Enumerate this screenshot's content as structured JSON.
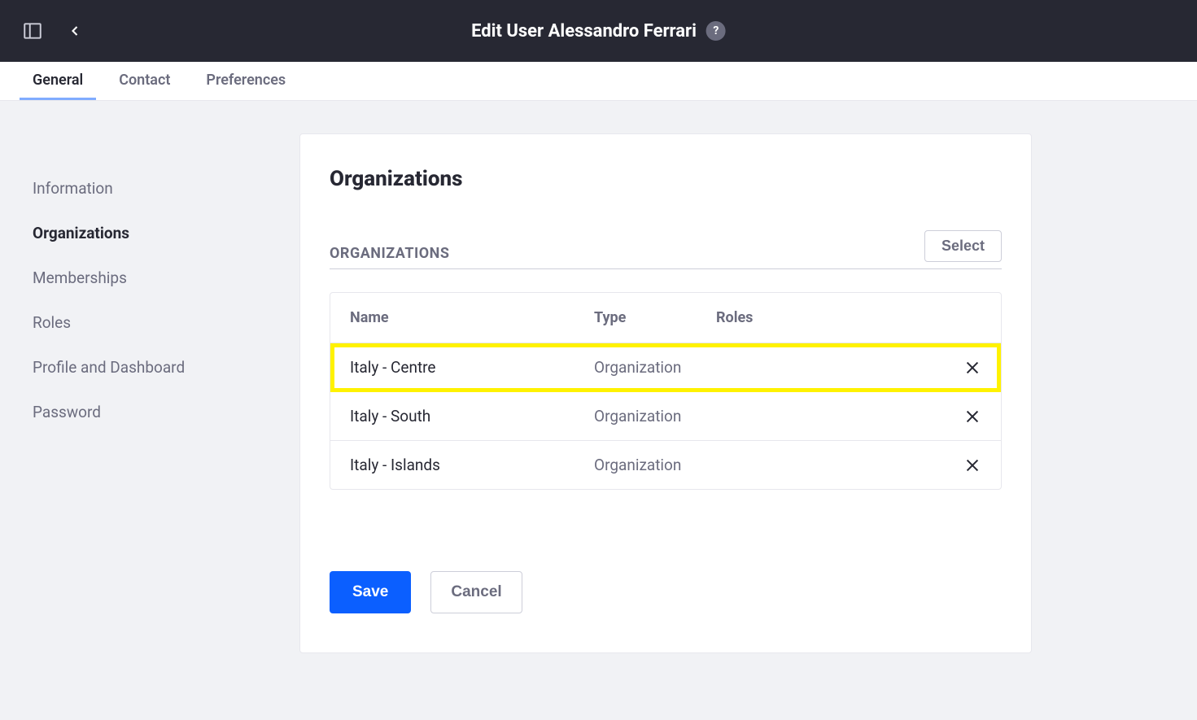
{
  "header": {
    "title": "Edit User Alessandro Ferrari",
    "help": "?"
  },
  "tabs": [
    {
      "label": "General",
      "active": true
    },
    {
      "label": "Contact",
      "active": false
    },
    {
      "label": "Preferences",
      "active": false
    }
  ],
  "sidebar": {
    "items": [
      {
        "label": "Information",
        "active": false
      },
      {
        "label": "Organizations",
        "active": true
      },
      {
        "label": "Memberships",
        "active": false
      },
      {
        "label": "Roles",
        "active": false
      },
      {
        "label": "Profile and Dashboard",
        "active": false
      },
      {
        "label": "Password",
        "active": false
      }
    ]
  },
  "panel": {
    "title": "Organizations",
    "section_label": "ORGANIZATIONS",
    "select_label": "Select"
  },
  "table": {
    "columns": {
      "name": "Name",
      "type": "Type",
      "roles": "Roles"
    },
    "rows": [
      {
        "name": "Italy - Centre",
        "type": "Organization",
        "roles": "",
        "highlight": true
      },
      {
        "name": "Italy - South",
        "type": "Organization",
        "roles": "",
        "highlight": false
      },
      {
        "name": "Italy - Islands",
        "type": "Organization",
        "roles": "",
        "highlight": false
      }
    ]
  },
  "actions": {
    "save": "Save",
    "cancel": "Cancel"
  }
}
